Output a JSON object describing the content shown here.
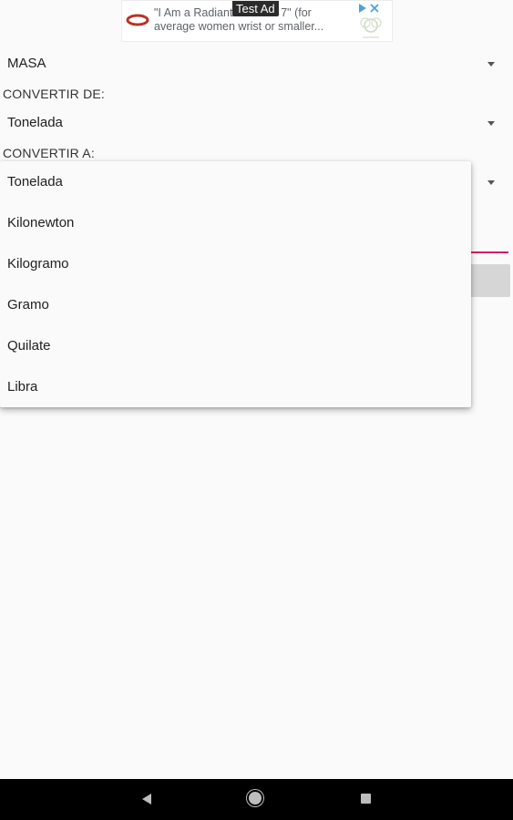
{
  "ad": {
    "label": "Test Ad",
    "line1": "\"I Am a Radiant Bracelet 7\" (for",
    "line2": "average women wrist or smaller..."
  },
  "category_spinner": {
    "value": "MASA",
    "icon": "dropdown-arrow-icon"
  },
  "convert_from": {
    "label": "CONVERTIR DE:",
    "value": "Tonelada",
    "icon": "dropdown-arrow-icon"
  },
  "convert_to": {
    "label": "CONVERTIR A:",
    "icon": "dropdown-arrow-icon"
  },
  "dropdown": {
    "options": [
      "Tonelada",
      "Kilonewton",
      "Kilogramo",
      "Gramo",
      "Quilate",
      "Libra"
    ]
  },
  "colors": {
    "accent": "#d81b60",
    "button": "#d6d6d6",
    "navbar": "#000000"
  },
  "nav_bar": {
    "icons": [
      "back-icon",
      "home-icon",
      "recents-icon"
    ]
  }
}
